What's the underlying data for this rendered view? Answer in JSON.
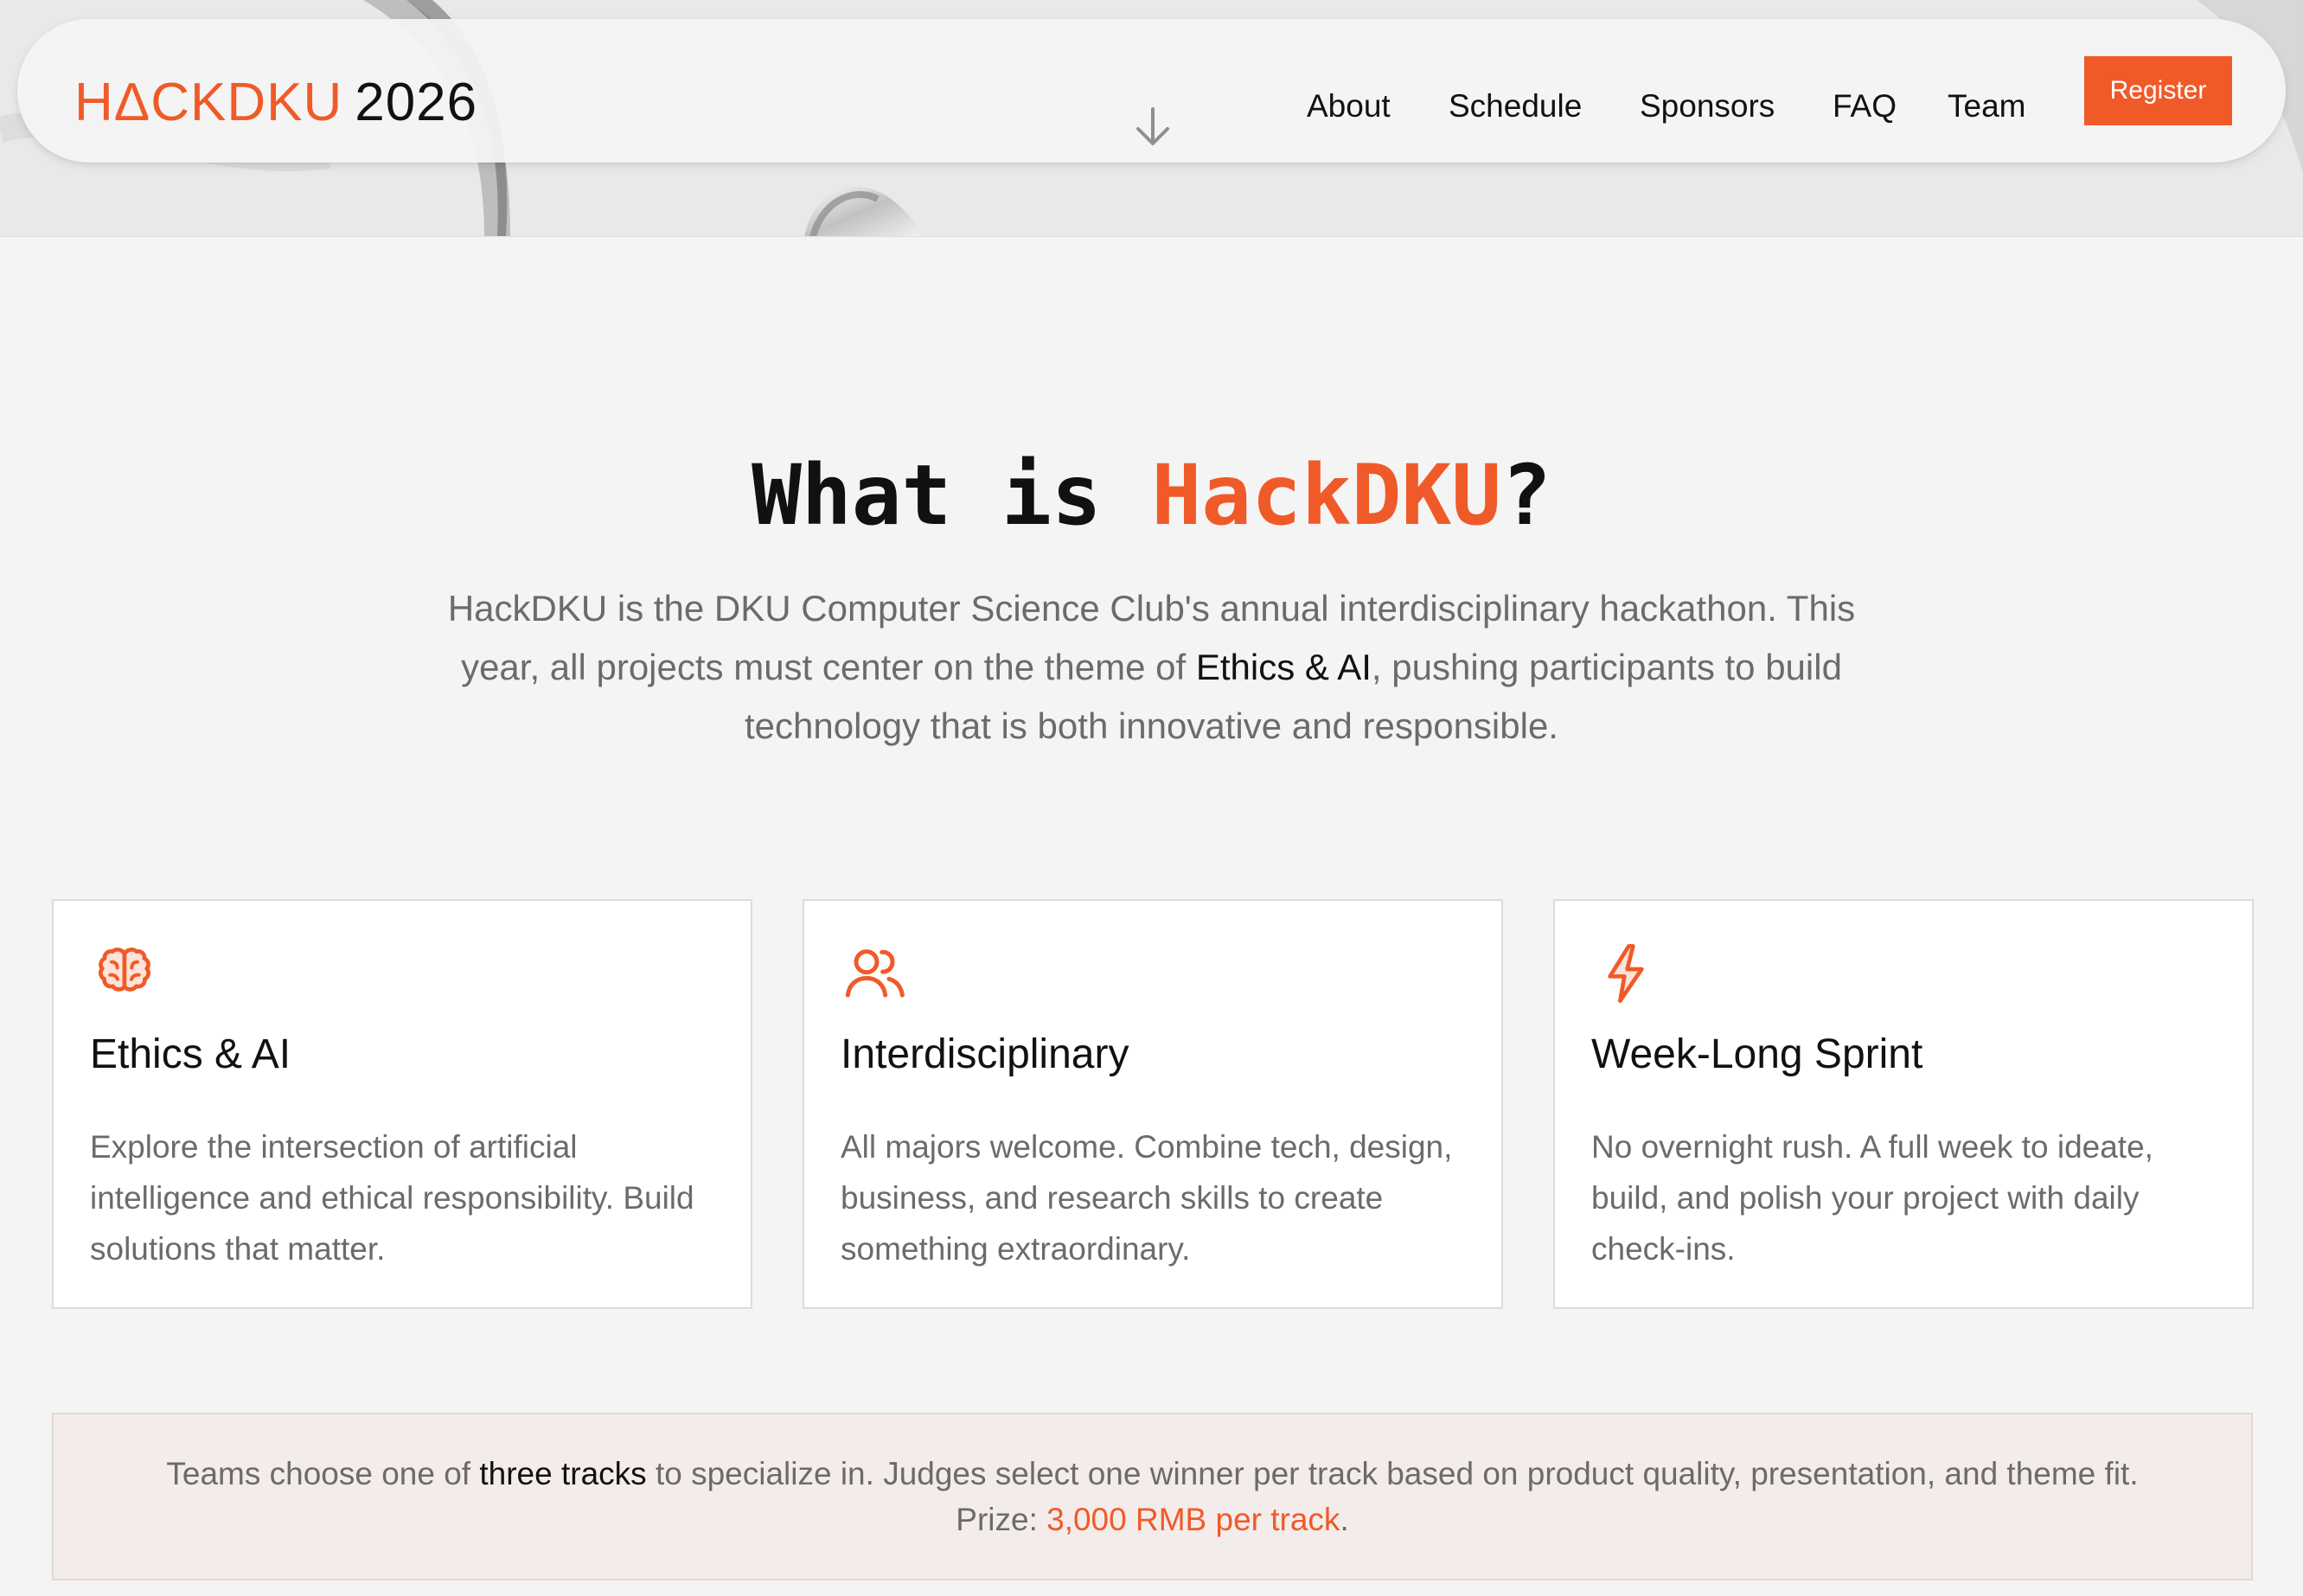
{
  "brand": {
    "logo_accent": "HΔCKDKU",
    "logo_year": "2026",
    "accent_color": "#f05a28"
  },
  "nav": {
    "links": [
      "About",
      "Schedule",
      "Sponsors",
      "FAQ",
      "Team"
    ],
    "register_label": "Register",
    "scroll_icon": "arrow-down-icon"
  },
  "about": {
    "title_prefix": "What is ",
    "title_brand": "HackDKU",
    "title_suffix": "?",
    "intro_part1": "HackDKU is the DKU Computer Science Club's annual interdisciplinary hackathon. This year, all projects must center on the theme of ",
    "intro_highlight": "Ethics & AI",
    "intro_part2": ", pushing participants to build technology that is both innovative and responsible."
  },
  "cards": [
    {
      "icon": "brain-icon",
      "title": "Ethics & AI",
      "description": "Explore the intersection of artificial intelligence and ethical responsibility. Build solutions that matter."
    },
    {
      "icon": "users-icon",
      "title": "Interdisciplinary",
      "description": "All majors welcome. Combine tech, design, business, and research skills to create something extraordinary."
    },
    {
      "icon": "lightning-icon",
      "title": "Week-Long Sprint",
      "description": "No overnight rush. A full week to ideate, build, and polish your project with daily check-ins."
    }
  ],
  "tracks": {
    "line1_part1": "Teams choose one of ",
    "line1_highlight": "three tracks",
    "line1_part2": " to specialize in. Judges select one winner per track based on product quality, presentation, and theme fit.",
    "line2_prefix": "Prize: ",
    "line2_prize": "3,000 RMB per track",
    "line2_suffix": "."
  }
}
